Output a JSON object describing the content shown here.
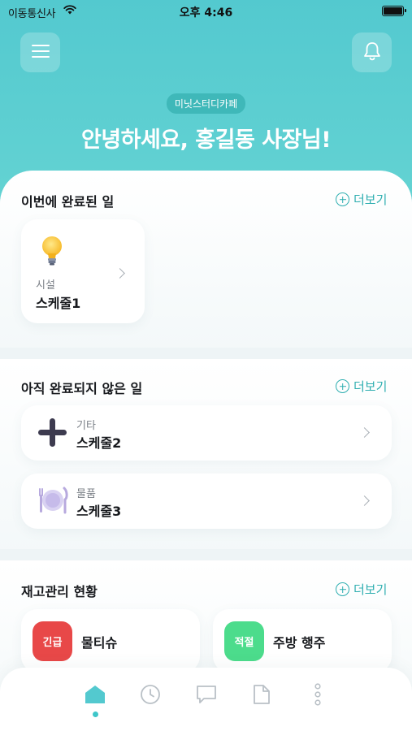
{
  "status_bar": {
    "carrier": "이동통신사",
    "time": "오후 4:46"
  },
  "header": {
    "cafe_name": "미닛스터디카페",
    "greeting": "안녕하세요, 홍길동 사장님!"
  },
  "completed": {
    "title": "이번에 완료된 일",
    "more_label": "더보기",
    "items": [
      {
        "category": "시설",
        "name": "스케줄1",
        "icon": "lightbulb-icon"
      }
    ]
  },
  "pending": {
    "title": "아직 완료되지 않은 일",
    "more_label": "더보기",
    "items": [
      {
        "category": "기타",
        "name": "스케줄2",
        "icon": "plus-icon"
      },
      {
        "category": "물품",
        "name": "스케줄3",
        "icon": "plate-cutlery-icon"
      }
    ]
  },
  "inventory": {
    "title": "재고관리 현황",
    "more_label": "더보기",
    "items": [
      {
        "badge": "긴급",
        "name": "물티슈",
        "badge_color": "#e84848"
      },
      {
        "badge": "적절",
        "name": "주방 행주",
        "badge_color": "#4cdc8c"
      }
    ]
  },
  "tabbar": {
    "tabs": [
      "home-icon",
      "clock-icon",
      "chat-icon",
      "document-icon",
      "more-vertical-icon"
    ],
    "active": 0
  },
  "colors": {
    "accent": "#53c9cf",
    "link": "#2eaeb0",
    "urgent": "#e84848",
    "ok": "#4cdc8c"
  }
}
